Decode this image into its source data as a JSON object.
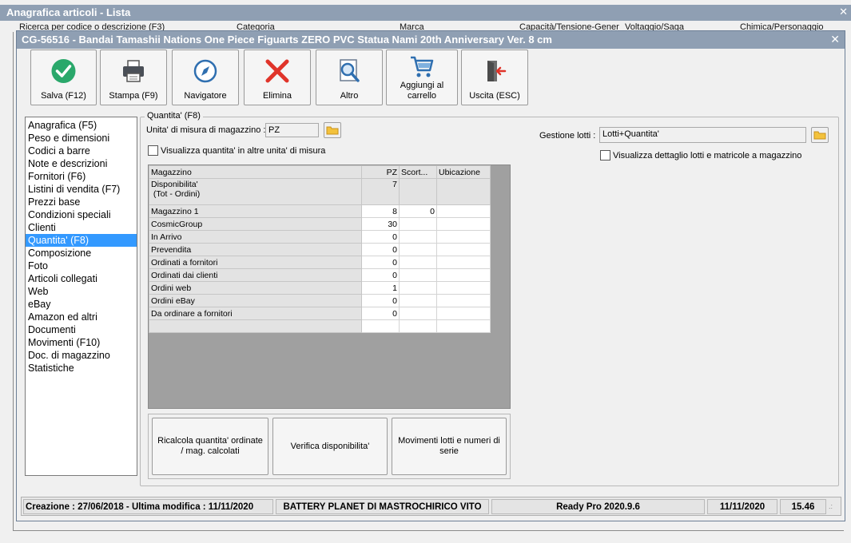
{
  "bg_window": {
    "title": "Anagrafica articoli  - Lista",
    "filters": [
      "Ricerca per codice o descrizione (F3)",
      "Categoria",
      "Marca",
      "Capacità/Tensione-Gener",
      "Voltaggio/Saga",
      "Chimica/Personaggio"
    ]
  },
  "dialog": {
    "title": "CG-56516 - Bandai Tamashii Nations One Piece Figuarts ZERO PVC Statua Nami 20th Anniversary Ver. 8 cm",
    "toolbar": [
      {
        "name": "save-button",
        "icon": "check-circle-icon",
        "label": "Salva (F12)"
      },
      {
        "name": "print-button",
        "icon": "printer-icon",
        "label": "Stampa (F9)"
      },
      {
        "name": "navigator-button",
        "icon": "compass-icon",
        "label": "Navigatore"
      },
      {
        "name": "delete-button",
        "icon": "x-icon",
        "label": "Elimina"
      },
      {
        "name": "more-button",
        "icon": "magnifier-icon",
        "label": "Altro"
      },
      {
        "name": "add-to-cart-button",
        "icon": "cart-icon",
        "label": "Aggiungi al carrello"
      },
      {
        "name": "exit-button",
        "icon": "exit-door-icon",
        "label": "Uscita (ESC)"
      }
    ],
    "nav": [
      "Anagrafica (F5)",
      "Peso e dimensioni",
      "Codici a barre",
      "Note e descrizioni",
      "Fornitori (F6)",
      "Listini di vendita (F7)",
      "Prezzi base",
      "Condizioni speciali",
      "Clienti",
      "Quantita' (F8)",
      "Composizione",
      "Foto",
      "Articoli collegati",
      "Web",
      "eBay",
      "Amazon ed altri",
      "Documenti",
      "Movimenti (F10)",
      "Doc. di magazzino",
      "Statistiche"
    ],
    "nav_selected_index": 9,
    "section": {
      "legend": "Quantita' (F8)",
      "uom_label": "Unita' di misura di magazzino :",
      "uom_value": "PZ",
      "show_other_units_label": "Visualizza quantita' in altre unita' di misura",
      "lots_label": "Gestione lotti :",
      "lots_value": "Lotti+Quantita'",
      "show_lots_detail_label": "Visualizza dettaglio lotti e matricole a magazzino"
    },
    "grid": {
      "headers": [
        "Magazzino",
        "PZ",
        "Scort...",
        "Ubicazione"
      ],
      "rows": [
        {
          "label": "Disponibilita'\n (Tot - Ordini)",
          "pz": "7",
          "scorta": "",
          "ubicazione": ""
        },
        {
          "label": "Magazzino 1",
          "pz": "8",
          "scorta": "0",
          "ubicazione": ""
        },
        {
          "label": "CosmicGroup",
          "pz": "30",
          "scorta": "",
          "ubicazione": ""
        },
        {
          "label": "In Arrivo",
          "pz": "0",
          "scorta": "",
          "ubicazione": ""
        },
        {
          "label": "Prevendita",
          "pz": "0",
          "scorta": "",
          "ubicazione": ""
        },
        {
          "label": "Ordinati a fornitori",
          "pz": "0",
          "scorta": "",
          "ubicazione": ""
        },
        {
          "label": "Ordinati dai clienti",
          "pz": "0",
          "scorta": "",
          "ubicazione": ""
        },
        {
          "label": "Ordini web",
          "pz": "1",
          "scorta": "",
          "ubicazione": ""
        },
        {
          "label": "Ordini eBay",
          "pz": "0",
          "scorta": "",
          "ubicazione": ""
        },
        {
          "label": "Da ordinare a fornitori",
          "pz": "0",
          "scorta": "",
          "ubicazione": ""
        },
        {
          "label": "",
          "pz": "",
          "scorta": "",
          "ubicazione": ""
        }
      ]
    },
    "actions": {
      "recalc": "Ricalcola quantita' ordinate / mag. calcolati",
      "check": "Verifica disponibilita'",
      "lots": "Movimenti lotti e numeri di serie"
    },
    "status": {
      "dates": "Creazione : 27/06/2018 - Ultima modifica : 11/11/2020",
      "company": "BATTERY PLANET DI MASTROCHIRICO VITO",
      "version": "Ready Pro 2020.9.6",
      "date": "11/11/2020",
      "time": "15.46"
    }
  },
  "colors": {
    "titlebar": "#8f9fb3",
    "selection": "#3399ff",
    "check_green": "#2aa86b",
    "delete_red": "#e0342a",
    "icon_blue": "#2f6fb0"
  }
}
